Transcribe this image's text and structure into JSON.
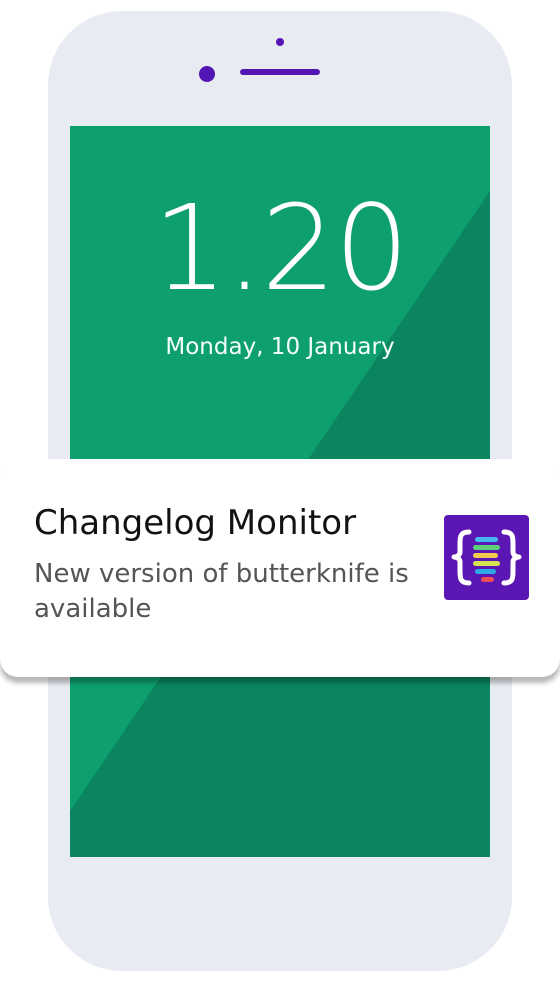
{
  "lock_screen": {
    "time": "1.20",
    "date": "Monday, 10 January"
  },
  "notification": {
    "title": "Changelog Monitor",
    "body": "New version of butterknife is available",
    "app_icon": "changelog-monitor-app-icon"
  },
  "colors": {
    "screen_green": "#0e9f6e",
    "screen_shade": "#0b8560",
    "phone_body": "#e8ebf1",
    "accent_purple": "#5316b4",
    "notification_bg": "#ffffff"
  }
}
